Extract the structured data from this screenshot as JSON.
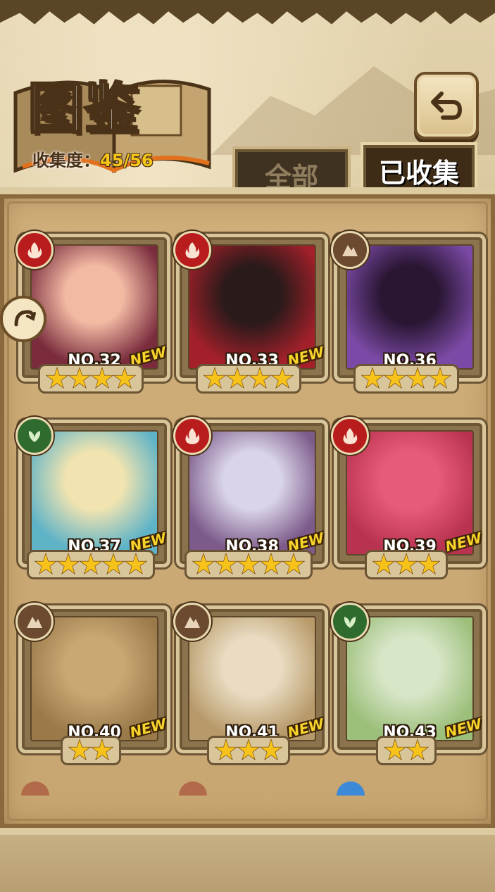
{
  "header": {
    "title": "图鉴",
    "collection_label": "收集度：",
    "collection_value": "45/56"
  },
  "tabs": [
    {
      "label": "全部",
      "active": false
    },
    {
      "label": "已收集",
      "active": true
    }
  ],
  "cards": [
    {
      "number": "NO.32",
      "element": "fire-icon",
      "stars": 4,
      "new": "NEW",
      "colors": [
        "#f2b9a3",
        "#7a2c3d"
      ]
    },
    {
      "number": "NO.33",
      "element": "fire-icon",
      "stars": 4,
      "new": "NEW",
      "colors": [
        "#2a1a1a",
        "#a3202a"
      ]
    },
    {
      "number": "NO.36",
      "element": "earth-icon",
      "stars": 4,
      "new": "",
      "colors": [
        "#2a1633",
        "#7b4aa6"
      ]
    },
    {
      "number": "NO.37",
      "element": "leaf-icon",
      "stars": 5,
      "new": "NEW",
      "colors": [
        "#f1e4b0",
        "#5fb3c7"
      ]
    },
    {
      "number": "NO.38",
      "element": "fire-icon",
      "stars": 5,
      "new": "NEW",
      "colors": [
        "#d9d4e8",
        "#7c5a8a"
      ]
    },
    {
      "number": "NO.39",
      "element": "fire-icon",
      "stars": 3,
      "new": "NEW",
      "colors": [
        "#e85a7a",
        "#b8334f"
      ]
    },
    {
      "number": "NO.40",
      "element": "earth-icon",
      "stars": 2,
      "new": "NEW",
      "colors": [
        "#c9a875",
        "#9b7a4a"
      ]
    },
    {
      "number": "NO.41",
      "element": "earth-icon",
      "stars": 3,
      "new": "NEW",
      "colors": [
        "#e9dcc2",
        "#b89a6a"
      ]
    },
    {
      "number": "NO.43",
      "element": "leaf-icon",
      "stars": 2,
      "new": "NEW",
      "colors": [
        "#d8e6c8",
        "#9cbf7a"
      ]
    }
  ]
}
